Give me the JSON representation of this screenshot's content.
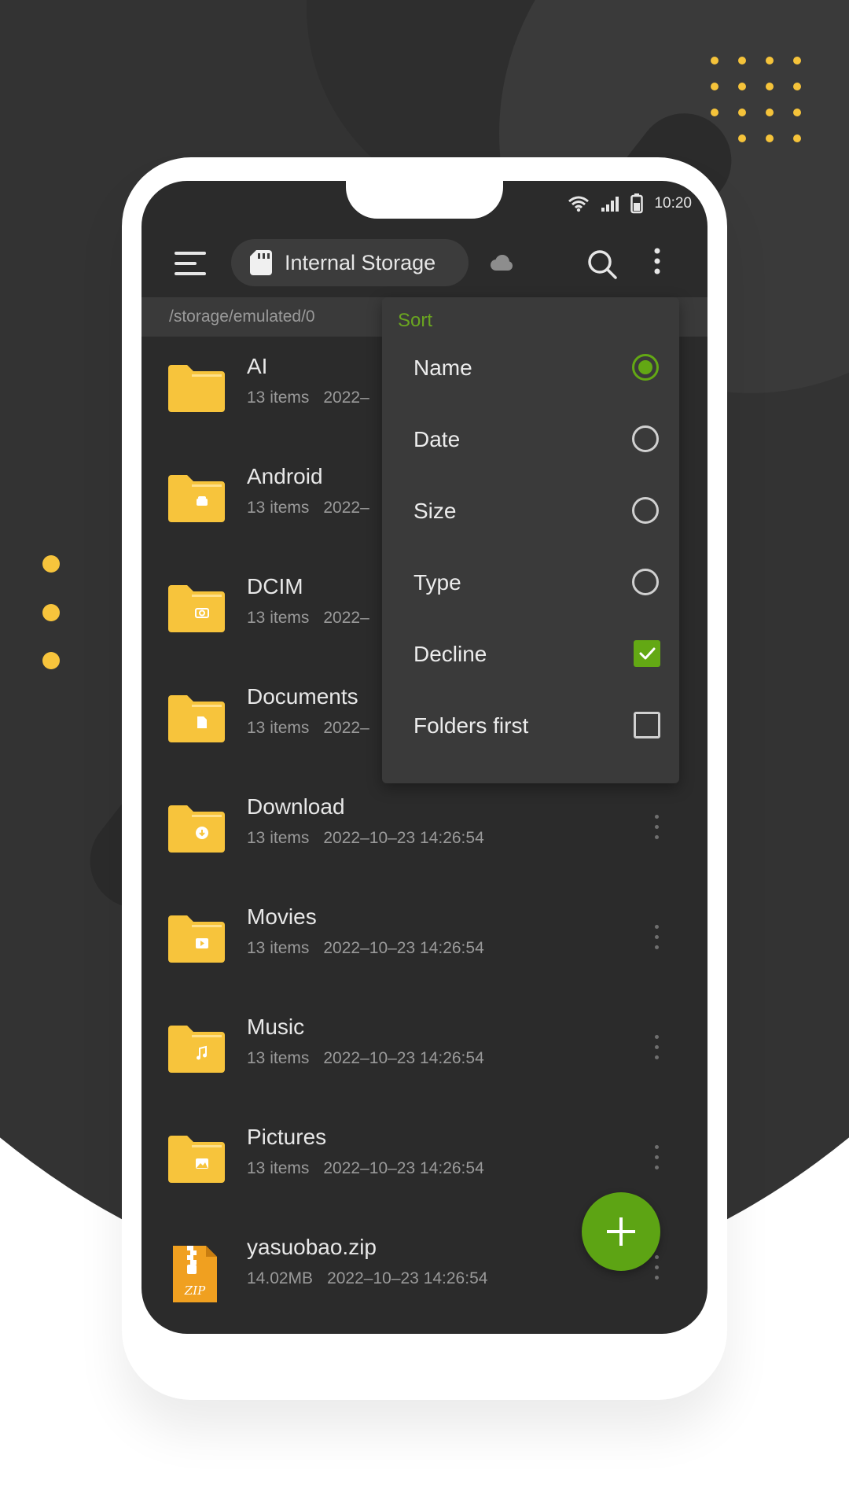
{
  "status_bar": {
    "time": "10:20"
  },
  "toolbar": {
    "storage_label": "Internal Storage"
  },
  "path": "/storage/emulated/0",
  "files": [
    {
      "name": "AI",
      "count": "13 items",
      "date": "2022–",
      "icon": "folder-icon"
    },
    {
      "name": "Android",
      "count": "13 items",
      "date": "2022–",
      "icon": "android-folder-icon"
    },
    {
      "name": "DCIM",
      "count": "13 items",
      "date": "2022–",
      "icon": "camera-folder-icon"
    },
    {
      "name": "Documents",
      "count": "13 items",
      "date": "2022–",
      "icon": "document-folder-icon"
    },
    {
      "name": "Download",
      "count": "13 items",
      "date": "2022–10–23 14:26:54",
      "icon": "download-folder-icon"
    },
    {
      "name": "Movies",
      "count": "13 items",
      "date": "2022–10–23 14:26:54",
      "icon": "video-folder-icon"
    },
    {
      "name": "Music",
      "count": "13 items",
      "date": "2022–10–23 14:26:54",
      "icon": "music-folder-icon"
    },
    {
      "name": "Pictures",
      "count": "13 items",
      "date": "2022–10–23 14:26:54",
      "icon": "image-folder-icon"
    },
    {
      "name": "yasuobao.zip",
      "count": "14.02MB",
      "date": "2022–10–23 14:26:54",
      "icon": "zip-file-icon"
    }
  ],
  "zip_badge": "ZIP",
  "sort_menu": {
    "title": "Sort",
    "options": [
      {
        "label": "Name",
        "control": "radio",
        "checked": true
      },
      {
        "label": "Date",
        "control": "radio",
        "checked": false
      },
      {
        "label": "Size",
        "control": "radio",
        "checked": false
      },
      {
        "label": "Type",
        "control": "radio",
        "checked": false
      },
      {
        "label": "Decline",
        "control": "checkbox",
        "checked": true
      },
      {
        "label": "Folders first",
        "control": "checkbox",
        "checked": false
      }
    ]
  },
  "colors": {
    "accent": "#63a814",
    "folder": "#f7c43c",
    "screen_bg": "#2b2b2b",
    "menu_bg": "#3a3a3a"
  }
}
